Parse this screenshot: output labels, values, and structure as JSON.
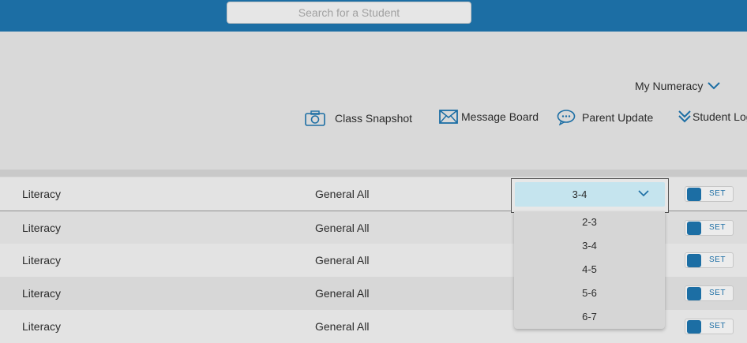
{
  "search": {
    "placeholder": "Search for a Student"
  },
  "header": {
    "my_numeracy": "My Numeracy"
  },
  "toolbar": {
    "class_snapshot": "Class Snapshot",
    "message_board": "Message Board",
    "parent_update": "Parent Update",
    "student_log": "Student Log"
  },
  "rows": [
    {
      "subject": "Literacy",
      "group": "General All",
      "level": "3-4",
      "toggle": "SET"
    },
    {
      "subject": "Literacy",
      "group": "General All",
      "level": "",
      "toggle": "SET"
    },
    {
      "subject": "Literacy",
      "group": "General All",
      "level": "",
      "toggle": "SET"
    },
    {
      "subject": "Literacy",
      "group": "General All",
      "level": "",
      "toggle": "SET"
    },
    {
      "subject": "Literacy",
      "group": "General All",
      "level": "",
      "toggle": "SET"
    }
  ],
  "select": {
    "value": "3-4",
    "options": [
      "2-3",
      "3-4",
      "4-5",
      "5-6",
      "6-7"
    ]
  },
  "colors": {
    "brand": "#1c6ea4",
    "select_bg": "#c5e4ee"
  }
}
